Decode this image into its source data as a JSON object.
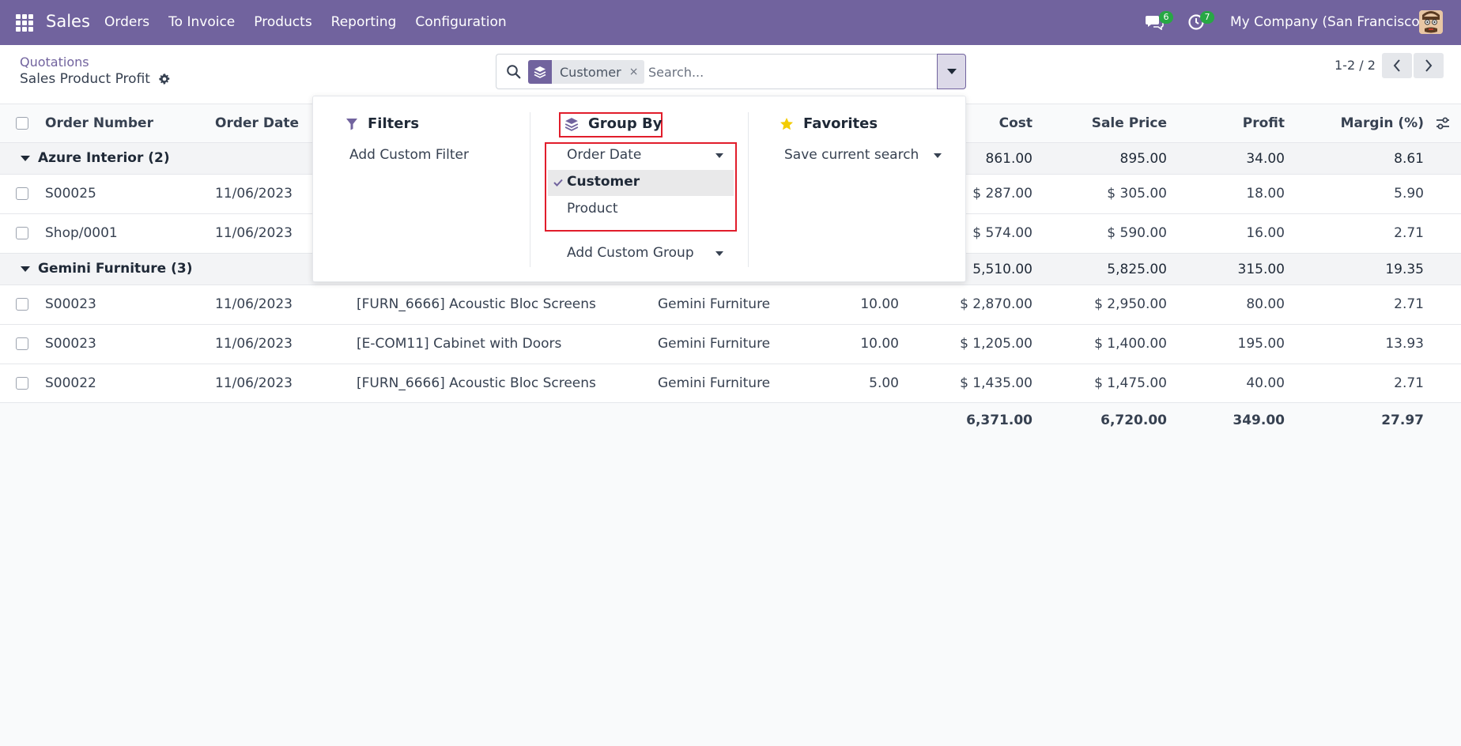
{
  "navbar": {
    "app_name": "Sales",
    "menu": [
      "Orders",
      "To Invoice",
      "Products",
      "Reporting",
      "Configuration"
    ],
    "chat_count": "6",
    "activity_count": "7",
    "company": "My Company (San Francisco)"
  },
  "control": {
    "breadcrumb": "Quotations",
    "title": "Sales Product Profit",
    "facet_label": "Customer",
    "facet_close": "×",
    "search_placeholder": "Search...",
    "pager": "1-2 / 2"
  },
  "table": {
    "headers": {
      "order_number": "Order Number",
      "order_date": "Order Date",
      "cost": "Cost",
      "sale_price": "Sale Price",
      "profit": "Profit",
      "margin": "Margin (%)"
    },
    "groups": [
      {
        "name": "Azure Interior (2)",
        "cost": "861.00",
        "sale_price": "895.00",
        "profit": "34.00",
        "margin": "8.61",
        "rows": [
          {
            "order": "S00025",
            "date": "11/06/2023",
            "product": "",
            "customer": "",
            "qty": "",
            "cost": "$ 287.00",
            "sale_price": "$ 305.00",
            "profit": "18.00",
            "margin": "5.90"
          },
          {
            "order": "Shop/0001",
            "date": "11/06/2023",
            "product": "",
            "customer": "",
            "qty": "",
            "cost": "$ 574.00",
            "sale_price": "$ 590.00",
            "profit": "16.00",
            "margin": "2.71"
          }
        ]
      },
      {
        "name": "Gemini Furniture (3)",
        "cost": "5,510.00",
        "sale_price": "5,825.00",
        "profit": "315.00",
        "margin": "19.35",
        "rows": [
          {
            "order": "S00023",
            "date": "11/06/2023",
            "product": "[FURN_6666] Acoustic Bloc Screens",
            "customer": "Gemini Furniture",
            "qty": "10.00",
            "cost": "$ 2,870.00",
            "sale_price": "$ 2,950.00",
            "profit": "80.00",
            "margin": "2.71"
          },
          {
            "order": "S00023",
            "date": "11/06/2023",
            "product": "[E-COM11] Cabinet with Doors",
            "customer": "Gemini Furniture",
            "qty": "10.00",
            "cost": "$ 1,205.00",
            "sale_price": "$ 1,400.00",
            "profit": "195.00",
            "margin": "13.93"
          },
          {
            "order": "S00022",
            "date": "11/06/2023",
            "product": "[FURN_6666] Acoustic Bloc Screens",
            "customer": "Gemini Furniture",
            "qty": "5.00",
            "cost": "$ 1,435.00",
            "sale_price": "$ 1,475.00",
            "profit": "40.00",
            "margin": "2.71"
          }
        ]
      }
    ],
    "totals": {
      "cost": "6,371.00",
      "sale_price": "6,720.00",
      "profit": "349.00",
      "margin": "27.97"
    }
  },
  "dropdown": {
    "filters": {
      "title": "Filters",
      "add_custom": "Add Custom Filter"
    },
    "group_by": {
      "title": "Group By",
      "options": [
        "Order Date",
        "Customer",
        "Product"
      ],
      "add_custom": "Add Custom Group",
      "selected": "Customer"
    },
    "favorites": {
      "title": "Favorites",
      "save": "Save current search"
    }
  },
  "colors": {
    "brand": "#71639e",
    "highlight": "#e11d2b",
    "badge": "#28a745",
    "favorite_star": "#f3cc00"
  }
}
